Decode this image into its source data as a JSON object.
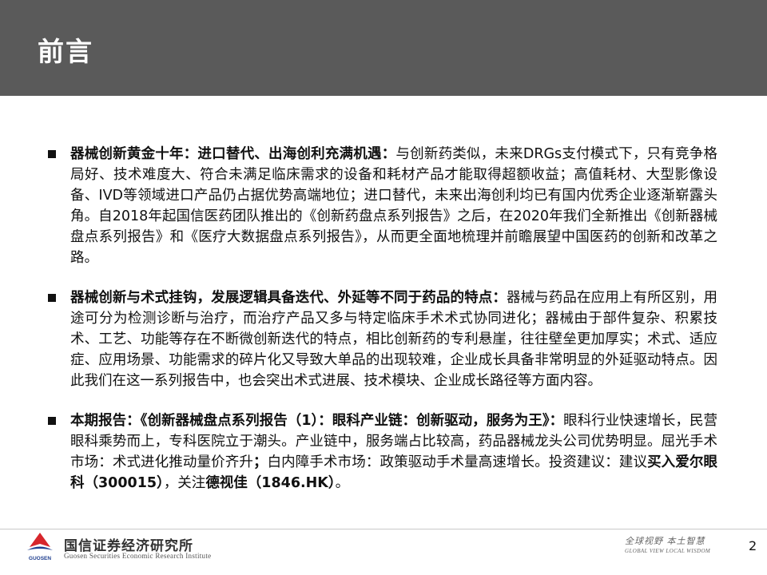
{
  "header": {
    "title": "前言"
  },
  "paragraphs": [
    {
      "runs": [
        {
          "text": "器械创新黄金十年：进口替代、出海创利充满机遇：",
          "bold": true
        },
        {
          "text": "与创新药类似，未来DRGs支付模式下，只有竞争格局好、技术难度大、符合未满足临床需求的设备和耗材产品才能取得超额收益；高值耗材、大型影像设备、IVD等领域进口产品仍占据优势高端地位；进口替代，未来出海创利均已有国内优秀企业逐渐崭露头角。自2018年起国信医药团队推出的《创新药盘点系列报告》之后，在2020年我们全新推出《创新器械盘点系列报告》和《医疗大数据盘点系列报告》，从而更全面地梳理并前瞻展望中国医药的创新和改革之路。",
          "bold": false
        }
      ]
    },
    {
      "runs": [
        {
          "text": "器械创新与术式挂钩，发展逻辑具备迭代、外延等不同于药品的特点：",
          "bold": true
        },
        {
          "text": "器械与药品在应用上有所区别，用途可分为检测诊断与治疗，而治疗产品又多与特定临床手术术式协同进化；器械由于部件复杂、积累技术、工艺、功能等存在不断微创新迭代的特点，相比创新药的专利悬崖，往往壁垒更加厚实；术式、适应症、应用场景、功能需求的碎片化又导致大单品的出现较难，企业成长具备非常明显的外延驱动特点。因此我们在这一系列报告中，也会突出术式进展、技术模块、企业成长路径等方面内容。",
          "bold": false
        }
      ]
    },
    {
      "runs": [
        {
          "text": "本期报告：《创新器械盘点系列报告（1）：眼科产业链：创新驱动，服务为王》：",
          "bold": true
        },
        {
          "text": "眼科行业快速增长，民营眼科乘势而上，专科医院立于潮头。产业链中，服务端占比较高，药品器械龙头公司优势明显。屈光手术市场：术式进化推动量价齐升",
          "bold": false
        },
        {
          "text": "；",
          "bold": true
        },
        {
          "text": "白内障手术市场：政策驱动手术量高速增长。投资建议：建议",
          "bold": false
        },
        {
          "text": "买入爱尔眼科（300015）",
          "bold": true
        },
        {
          "text": "，关注",
          "bold": false
        },
        {
          "text": "德视佳（1846.HK）",
          "bold": true
        },
        {
          "text": "。",
          "bold": false
        }
      ]
    }
  ],
  "footer": {
    "logo_cn": "国信证券经济研究所",
    "logo_en": "Guosen Securities Economic Research Institute",
    "logo_mark": "GUOSEN",
    "slogan_cn": "全球视野  本土智慧",
    "slogan_en": "GLOBAL VIEW  LOCAL WISDOM",
    "page_number": "2"
  },
  "colors": {
    "header_bg": "#5a5a5a",
    "logo_red": "#d7262c",
    "logo_blue": "#1f3f8f"
  }
}
